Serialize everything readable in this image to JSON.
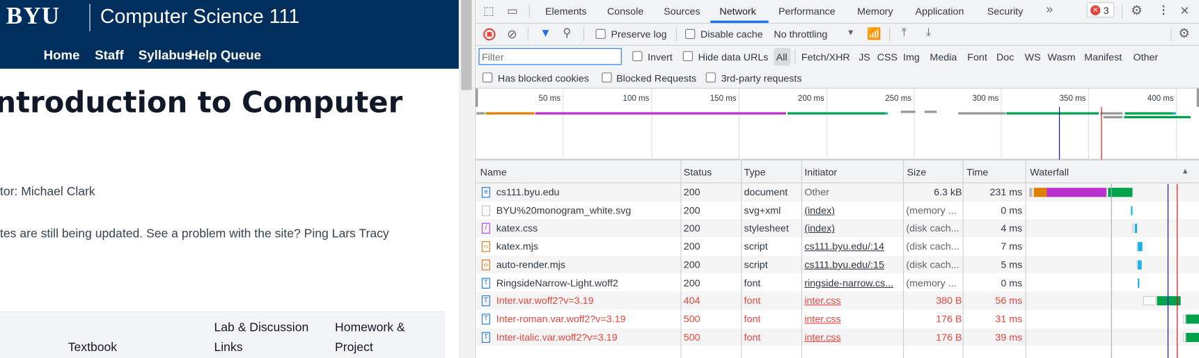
{
  "page": {
    "logo": "BYU",
    "course_title": "Computer Science 111",
    "nav": [
      "Home",
      "Staff",
      "Syllabus",
      "Help Queue"
    ],
    "heading": "ntroduction to Computer",
    "instructor": "tor: Michael Clark",
    "notice": "tes are still being updated. See a problem with the site? Ping Lars Tracy",
    "table_headers": {
      "textbook": "Textbook",
      "lab1": "Lab & Discussion",
      "lab2": "Links",
      "hw1": "Homework &",
      "hw2": "Project"
    }
  },
  "devtools": {
    "tabs": [
      "Elements",
      "Console",
      "Sources",
      "Network",
      "Performance",
      "Memory",
      "Application",
      "Security"
    ],
    "active_tab": "Network",
    "more_tabs": "»",
    "error_count": "3",
    "toolbar": {
      "preserve_log": "Preserve log",
      "disable_cache": "Disable cache",
      "throttling": "No throttling"
    },
    "filter": {
      "placeholder": "Filter",
      "invert": "Invert",
      "hide_data_urls": "Hide data URLs",
      "types": [
        "All",
        "Fetch/XHR",
        "JS",
        "CSS",
        "Img",
        "Media",
        "Font",
        "Doc",
        "WS",
        "Wasm",
        "Manifest",
        "Other"
      ],
      "active_type": "All",
      "has_blocked_cookies": "Has blocked cookies",
      "blocked_requests": "Blocked Requests",
      "third_party": "3rd-party requests"
    },
    "overview_ticks": [
      "50 ms",
      "100 ms",
      "150 ms",
      "200 ms",
      "250 ms",
      "300 ms",
      "350 ms",
      "400 ms"
    ],
    "columns": [
      "Name",
      "Status",
      "Type",
      "Initiator",
      "Size",
      "Time",
      "Waterfall"
    ],
    "rows": [
      {
        "name": "cs111.byu.edu",
        "status": "200",
        "type": "document",
        "initiator": "Other",
        "size": "6.3 kB",
        "time": "231 ms",
        "icon": "document-icon",
        "error": false
      },
      {
        "name": "BYU%20monogram_white.svg",
        "status": "200",
        "type": "svg+xml",
        "initiator": "(index)",
        "size": "(memory ...",
        "time": "0 ms",
        "icon": "image-icon",
        "error": false
      },
      {
        "name": "katex.css",
        "status": "200",
        "type": "stylesheet",
        "initiator": "(index)",
        "size": "(disk cach...",
        "time": "4 ms",
        "icon": "stylesheet-icon",
        "error": false
      },
      {
        "name": "katex.mjs",
        "status": "200",
        "type": "script",
        "initiator": "cs111.byu.edu/:14",
        "size": "(disk cach...",
        "time": "7 ms",
        "icon": "script-icon",
        "error": false
      },
      {
        "name": "auto-render.mjs",
        "status": "200",
        "type": "script",
        "initiator": "cs111.byu.edu/:15",
        "size": "(disk cach...",
        "time": "5 ms",
        "icon": "script-icon",
        "error": false
      },
      {
        "name": "RingsideNarrow-Light.woff2",
        "status": "200",
        "type": "font",
        "initiator": "ringside-narrow.cs...",
        "size": "(memory ...",
        "time": "0 ms",
        "icon": "font-icon",
        "error": false
      },
      {
        "name": "Inter.var.woff2?v=3.19",
        "status": "404",
        "type": "font",
        "initiator": "inter.css",
        "size": "380 B",
        "time": "56 ms",
        "icon": "font-icon",
        "error": true
      },
      {
        "name": "Inter-roman.var.woff2?v=3.19",
        "status": "500",
        "type": "font",
        "initiator": "inter.css",
        "size": "176 B",
        "time": "31 ms",
        "icon": "font-icon",
        "error": true
      },
      {
        "name": "Inter-italic.var.woff2?v=3.19",
        "status": "500",
        "type": "font",
        "initiator": "inter.css",
        "size": "176 B",
        "time": "39 ms",
        "icon": "font-icon",
        "error": true
      }
    ],
    "colors": {
      "accent": "#1a73e8",
      "error": "#e8453c",
      "header_navy": "#002e5d"
    }
  }
}
